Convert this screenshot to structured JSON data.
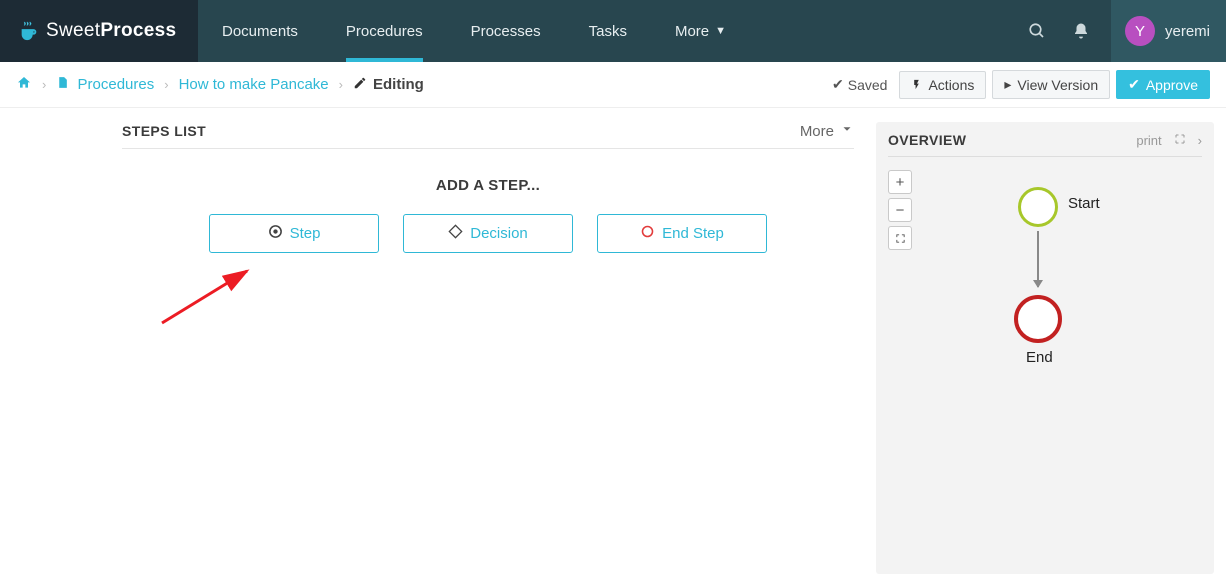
{
  "brand": {
    "part1": "Sweet",
    "part2": "Process"
  },
  "nav": {
    "documents": "Documents",
    "procedures": "Procedures",
    "processes": "Processes",
    "tasks": "Tasks",
    "more": "More"
  },
  "user": {
    "initial": "Y",
    "name": "yeremi"
  },
  "breadcrumb": {
    "procedures": "Procedures",
    "doc": "How to make Pancake",
    "editing": "Editing"
  },
  "subbar": {
    "saved": "Saved",
    "actions": "Actions",
    "view_version": "View Version",
    "approve": "Approve"
  },
  "steps": {
    "title": "STEPS LIST",
    "more": "More",
    "add_title": "ADD A STEP...",
    "step_label": "Step",
    "decision_label": "Decision",
    "end_label": "End Step"
  },
  "overview": {
    "title": "OVERVIEW",
    "print": "print",
    "start": "Start",
    "end": "End"
  }
}
